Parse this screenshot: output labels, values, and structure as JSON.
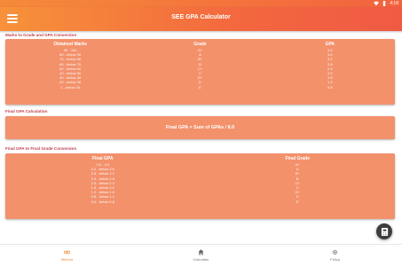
{
  "status": {
    "time": "4:18"
  },
  "app": {
    "title": "SEE GPA Calculator"
  },
  "section1": {
    "title": "Marks to Grade and GPA Conversion",
    "headers": [
      "Obtained Marks",
      "Grade",
      "GPA"
    ],
    "rows": [
      [
        "90 - 100",
        "A+",
        "4.0"
      ],
      [
        "80 - below 90",
        "A",
        "3.6"
      ],
      [
        "70 - below 80",
        "B+",
        "3.2"
      ],
      [
        "60 - below 70",
        "B",
        "2.8"
      ],
      [
        "50 - below 60",
        "C+",
        "2.4"
      ],
      [
        "40 - below 50",
        "C",
        "2.0"
      ],
      [
        "30 - below 40",
        "D+",
        "1.6"
      ],
      [
        "20 - below 30",
        "D",
        "1.2"
      ],
      [
        "1 - below 20",
        "E",
        "0.8"
      ]
    ]
  },
  "section2": {
    "title": "Final GPA Calculation",
    "formula": "Final GPA = Sum of GPAs / 8.0"
  },
  "section3": {
    "title": "Final GPA to Final Grade Conversion",
    "headers": [
      "Final GPA",
      "Final Grade"
    ],
    "rows": [
      [
        "3.6 - 4.0",
        "A+"
      ],
      [
        "3.2 - below 3.6",
        "A"
      ],
      [
        "2.8 - below 3.2",
        "B+"
      ],
      [
        "2.4 - below 2.8",
        "B"
      ],
      [
        "2.0 - below 2.4",
        "C+"
      ],
      [
        "1.6 - below 2.0",
        "C"
      ],
      [
        "1.2 - below 1.6",
        "D+"
      ],
      [
        "0.8 - below 1.2",
        "D"
      ],
      [
        "0.0 - below 0.8",
        "E"
      ]
    ]
  },
  "nav": {
    "items": [
      {
        "label": "Method",
        "icon": "link-icon",
        "active": true
      },
      {
        "label": "Calculator",
        "icon": "home-icon",
        "active": false
      },
      {
        "label": "Policy",
        "icon": "gear-icon",
        "active": false
      }
    ]
  },
  "colors": {
    "accent": "#f3916b",
    "appbar": "#f3673f",
    "section_title": "#c3424f",
    "active_nav": "#f08a3a"
  }
}
